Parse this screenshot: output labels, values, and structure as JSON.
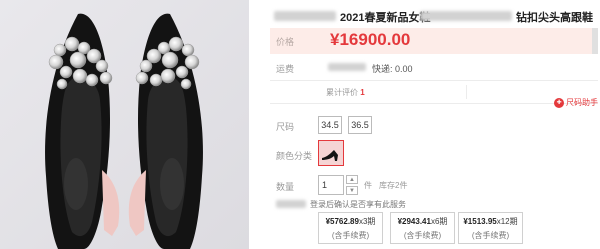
{
  "product": {
    "title_part1": "2021春夏新品女鞋",
    "title_part2": "钻扣尖头高跟鞋"
  },
  "price": {
    "label": "价格",
    "value": "¥16900.00"
  },
  "shipping": {
    "label": "运费",
    "text": "快递: 0.00"
  },
  "reviews": {
    "label": "累计评价",
    "count": "1"
  },
  "size_helper": {
    "label": "尺码助手"
  },
  "size": {
    "label": "尺码",
    "options": [
      "34.5",
      "36.5"
    ]
  },
  "color": {
    "label": "颜色分类"
  },
  "quantity": {
    "label": "数量",
    "value": "1",
    "unit": "件",
    "stock": "库存2件"
  },
  "installment": {
    "text": "登录后确认是否享有此服务",
    "plans": [
      {
        "amount": "¥5762.89",
        "term": "x3期",
        "fee": "(含手续费)"
      },
      {
        "amount": "¥2943.41",
        "term": "x6期",
        "fee": "(含手续费)"
      },
      {
        "amount": "¥1513.95",
        "term": "x12期",
        "fee": "(含手续费)"
      }
    ]
  },
  "colors": {
    "accent": "#e4393c",
    "price_bg": "#fdece8"
  }
}
